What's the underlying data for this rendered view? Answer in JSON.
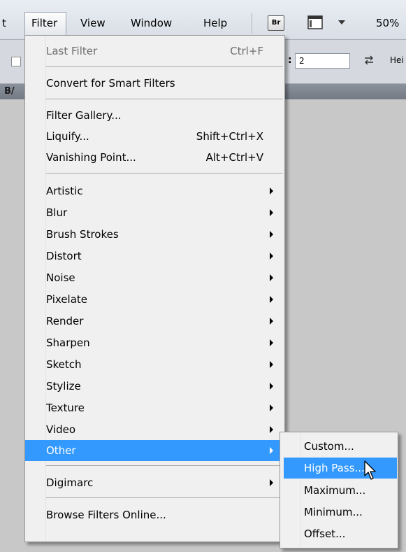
{
  "menubar": {
    "partial_left": "t",
    "items": [
      "Filter",
      "View",
      "Window",
      "Help"
    ],
    "bridge_label": "Br",
    "zoom": "50%"
  },
  "options_bar": {
    "colon": ":",
    "input_value": "2",
    "trailing_label": "Hei"
  },
  "doc_tab": {
    "partial_text": "B/"
  },
  "filter_menu": {
    "last_filter": {
      "label": "Last Filter",
      "shortcut": "Ctrl+F"
    },
    "convert": "Convert for Smart Filters",
    "filter_gallery": "Filter Gallery...",
    "liquify": {
      "label": "Liquify...",
      "shortcut": "Shift+Ctrl+X"
    },
    "vanishing_point": {
      "label": "Vanishing Point...",
      "shortcut": "Alt+Ctrl+V"
    },
    "submenus": [
      "Artistic",
      "Blur",
      "Brush Strokes",
      "Distort",
      "Noise",
      "Pixelate",
      "Render",
      "Sharpen",
      "Sketch",
      "Stylize",
      "Texture",
      "Video",
      "Other"
    ],
    "digimarc": "Digimarc",
    "browse_online": "Browse Filters Online..."
  },
  "other_submenu": {
    "items": [
      "Custom...",
      "High Pass...",
      "Maximum...",
      "Minimum...",
      "Offset..."
    ]
  },
  "colors": {
    "highlight": "#3399ff",
    "menu_bg": "#f0f0f0",
    "workspace_bg": "#c8c8c8"
  },
  "icons": [
    "screen-mode-icon",
    "dropdown-arrow-icon",
    "swap-icon",
    "submenu-arrow-icon",
    "mouse-cursor-icon"
  ]
}
